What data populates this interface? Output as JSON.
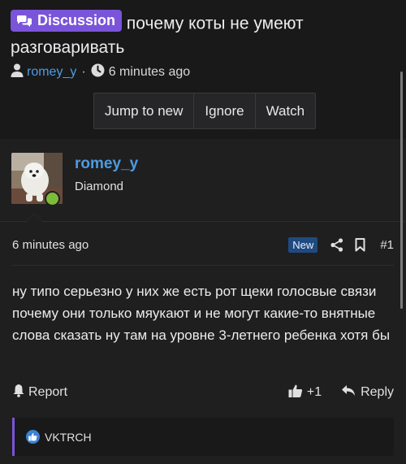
{
  "thread": {
    "badge_label": "Discussion",
    "title": "почему коты не умеют разговаривать",
    "author": "romey_y",
    "separator": "·",
    "time": "6 minutes ago",
    "actions": [
      "Jump to new",
      "Ignore",
      "Watch"
    ]
  },
  "post": {
    "username": "romey_y",
    "user_title": "Diamond",
    "time": "6 minutes ago",
    "new_label": "New",
    "number": "#1",
    "body": "ну типо серьезно у них же есть рот щеки голосвые связи почему они только мяукают и не могут какие-то внятные слова сказать ну там на уровне 3-летнего ребенка хотя бы",
    "report_label": "Report",
    "like_count": "+1",
    "reply_label": "Reply",
    "liked_by": "VKTRCH"
  },
  "colors": {
    "badge": "#7a54d9",
    "link": "#4d9ce0",
    "online": "#7dbb3a",
    "new_badge": "#1f4a80",
    "like": "#3b82d6"
  },
  "icons": {
    "badge": "discussion-bubbles-icon",
    "author": "user-icon",
    "time": "clock-icon",
    "share": "share-icon",
    "bookmark": "bookmark-icon",
    "report": "bell-icon",
    "like": "thumbs-up-icon",
    "reply": "reply-arrow-icon"
  }
}
